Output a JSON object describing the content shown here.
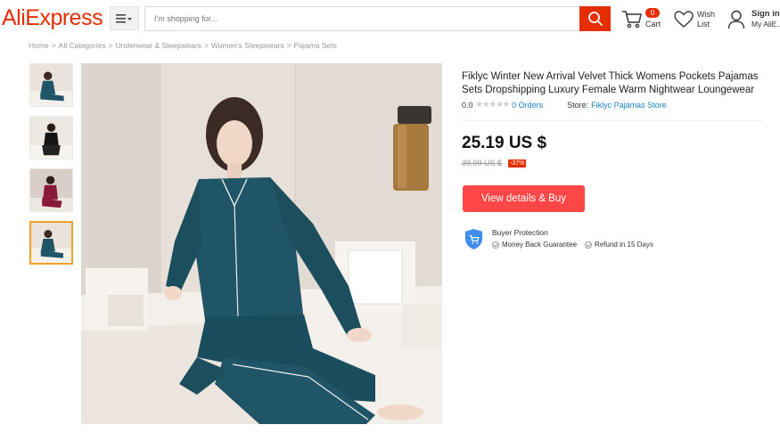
{
  "header": {
    "logo": "AliExpress",
    "search_placeholder": "I'm shopping for...",
    "cart_count": "0",
    "cart_label": "Cart",
    "wish_line1": "Wish",
    "wish_line2": "List",
    "signin_line1": "Sign in",
    "signin_line2": "My AliE..."
  },
  "breadcrumb": [
    "Home",
    "All Categories",
    "Underwear & Sleepwears",
    "Women's Sleepwears",
    "Pajama Sets"
  ],
  "breadcrumb_sep": ">",
  "product": {
    "title": "Fiklyc Winter New Arrival Velvet Thick Womens Pockets Pajamas Sets Dropshipping Luxury Female Warm Nightwear Loungewear",
    "rating": "0.0",
    "stars": "★★★★★",
    "orders": "0 Orders",
    "store_label": "Store:",
    "store_name": "Fiklyc Pajamas Store",
    "price": "25.19 US $",
    "original_price": "39.99 US $",
    "discount": "-37%",
    "buy_button": "View details & Buy",
    "protection_title": "Buyer Protection",
    "protection_item1": "Money Back Guarantee",
    "protection_item2": "Refund in 15 Days"
  },
  "colors": {
    "brand": "#e62e04",
    "buy_button": "#ff4747",
    "link": "#1a7fc4",
    "pajama_teal": "#1f5566",
    "thumb_active_border": "#f0a029"
  },
  "icons": [
    "menu-icon",
    "search-icon",
    "cart-icon",
    "heart-icon",
    "user-icon",
    "shield-cart-icon",
    "check-circle-icon"
  ]
}
